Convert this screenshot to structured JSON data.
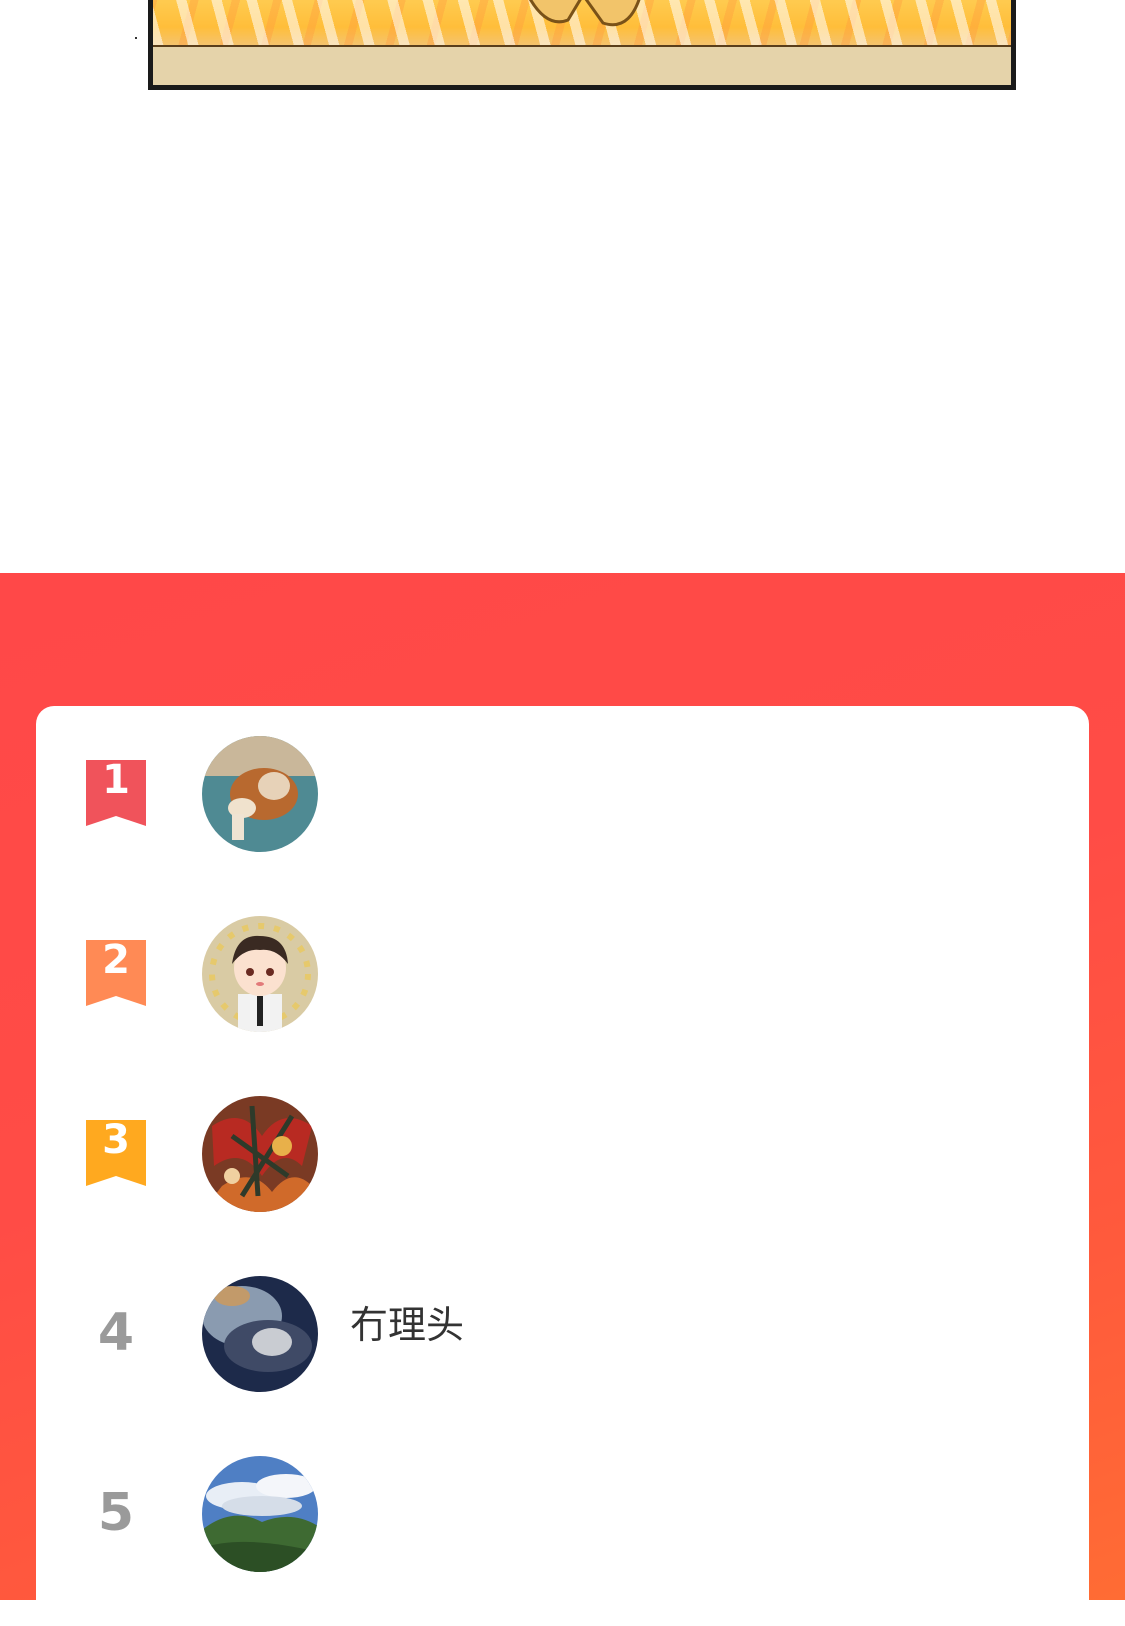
{
  "colors": {
    "section_bg_start": "#ff4848",
    "section_bg_end": "#ff6c34",
    "rank1": "#f0535b",
    "rank2": "#ff8a55",
    "rank3": "#ffa91f",
    "rank_plain": "#9a9a9a",
    "card_bg": "#ffffff"
  },
  "comic": {
    "description_icon": "comic-panel-image"
  },
  "ranking": {
    "items": [
      {
        "rank": "1",
        "name": "",
        "avatar": "dog-avatar"
      },
      {
        "rank": "2",
        "name": "",
        "avatar": "cartoon-boy-avatar"
      },
      {
        "rank": "3",
        "name": "",
        "avatar": "red-flowers-avatar"
      },
      {
        "rank": "4",
        "name": "冇理头",
        "avatar": "dark-photo-avatar"
      },
      {
        "rank": "5",
        "name": "",
        "avatar": "mountain-sky-avatar"
      }
    ]
  }
}
